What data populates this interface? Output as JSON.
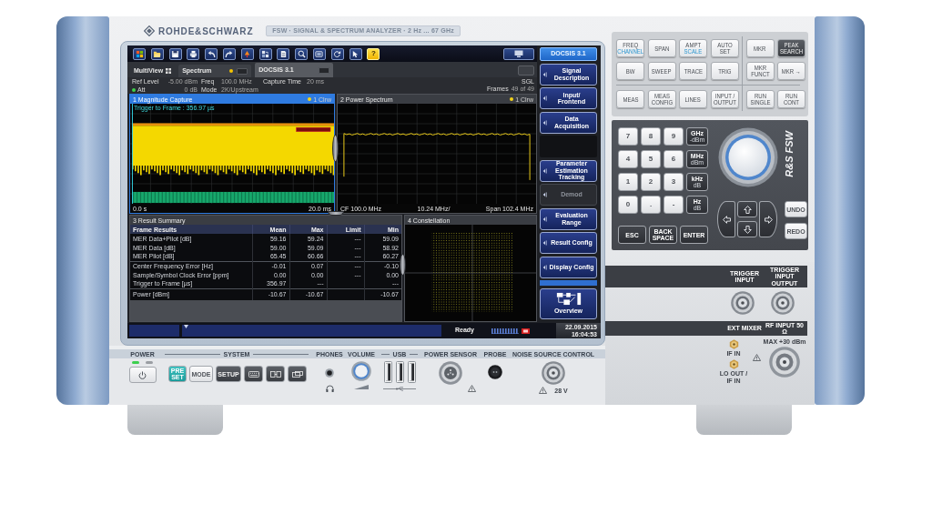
{
  "header": {
    "brand": "ROHDE&SCHWARZ",
    "title": "FSW · SIGNAL & SPECTRUM ANALYZER · 2 Hz ... 67 GHz"
  },
  "screen": {
    "toolbar": [
      {
        "kind": "start",
        "highlighted": false
      },
      {
        "kind": "open",
        "highlighted": false
      },
      {
        "kind": "save",
        "highlighted": false
      },
      {
        "kind": "print",
        "highlighted": false
      },
      {
        "kind": "undo",
        "highlighted": false
      },
      {
        "kind": "redo",
        "highlighted": false
      },
      {
        "kind": "marker",
        "highlighted": false
      },
      {
        "kind": "layout",
        "highlighted": false
      },
      {
        "kind": "report",
        "highlighted": false
      },
      {
        "kind": "zoom",
        "highlighted": false
      },
      {
        "kind": "screen",
        "highlighted": false
      },
      {
        "kind": "refresh",
        "highlighted": false
      },
      {
        "kind": "cursor",
        "highlighted": false
      },
      {
        "kind": "help",
        "label": "?",
        "highlighted": true
      }
    ],
    "softkey_header": "DOCSIS 3.1",
    "tabs": [
      {
        "kind": "multiview",
        "label": "MultiView",
        "selected": false,
        "running": false
      },
      {
        "kind": "channel",
        "label": "Spectrum",
        "selected": false,
        "running": true
      },
      {
        "kind": "channel",
        "label": "DOCSIS 3.1",
        "selected": true,
        "running": false
      }
    ],
    "info": {
      "rows": [
        [
          {
            "label": "Ref Level",
            "value": "-5.00 dBm",
            "dot": false
          },
          {
            "label": "Freq",
            "value": "100.0 MHz",
            "dot": false
          },
          {
            "label": "Capture Time",
            "value": "20 ms",
            "dot": false
          }
        ],
        [
          {
            "label": "Att",
            "value": "0 dB",
            "dot": true
          },
          {
            "label": "Mode",
            "value": "2K/Upstream",
            "dot": false
          }
        ]
      ],
      "sweep": "SGL",
      "frames_label": "Frames",
      "frames": "49 of 49"
    },
    "windows": [
      {
        "kind": "capture",
        "title": "1 Magnitude Capture",
        "selected": true,
        "trace": "1 Clrw",
        "annotation": "Trigger to Frame : 356.97 µs",
        "axis": [
          "0.0 s",
          "20.0 ms"
        ]
      },
      {
        "kind": "spectrum",
        "title": "2 Power Spectrum",
        "selected": false,
        "trace": "1 Clrw",
        "axis": [
          "CF 100.0 MHz",
          "10.24 MHz/",
          "Span 102.4 MHz"
        ]
      },
      {
        "kind": "table",
        "title": "3 Result Summary",
        "selected": false,
        "columns": [
          "Frame Results",
          "Mean",
          "Max",
          "Limit",
          "Min"
        ],
        "groups": [
          [
            {
              "label": "MER Data+Pilot [dB]",
              "mean": "59.16",
              "max": "59.24",
              "limit": "---",
              "min": "59.09"
            },
            {
              "label": "MER Data [dB]",
              "mean": "59.00",
              "max": "59.09",
              "limit": "---",
              "min": "58.92"
            },
            {
              "label": "MER Pilot [dB]",
              "mean": "65.45",
              "max": "60.66",
              "limit": "---",
              "min": "60.27"
            }
          ],
          [
            {
              "label": "Center Frequency Error [Hz]",
              "mean": "-0.01",
              "max": "0.07",
              "limit": "---",
              "min": "-0.10"
            },
            {
              "label": "Sample/Symbol Clock Error [ppm]",
              "mean": "0.00",
              "max": "0.00",
              "limit": "---",
              "min": "0.00"
            },
            {
              "label": "Trigger to Frame [µs]",
              "mean": "356.97",
              "max": "---",
              "min": "---"
            }
          ],
          [
            {
              "label": "Power [dBm]",
              "mean": "-10.67",
              "max": "-10.67",
              "min": "-10.67"
            }
          ]
        ]
      },
      {
        "kind": "constellation",
        "title": "4 Constellation",
        "selected": false
      }
    ],
    "softkeys": [
      {
        "kind": "key",
        "label": "Signal Description",
        "disabled": false
      },
      {
        "kind": "key",
        "label": "Input/ Frontend",
        "disabled": false
      },
      {
        "kind": "key",
        "label": "Data Acquisition",
        "disabled": false
      },
      {
        "kind": "blank"
      },
      {
        "kind": "key",
        "label": "Parameter Estimation Tracking",
        "disabled": false
      },
      {
        "kind": "key",
        "label": "Demod",
        "disabled": true
      },
      {
        "kind": "key",
        "label": "Evaluation Range",
        "disabled": false
      },
      {
        "kind": "key",
        "label": "Result Config",
        "disabled": false
      },
      {
        "kind": "key",
        "label": "Display Config",
        "disabled": false
      },
      {
        "kind": "bar"
      },
      {
        "kind": "overview",
        "label": "Overview"
      }
    ],
    "status_bar": {
      "status": "Ready",
      "date": "22.09.2015",
      "time": "16:04:53"
    }
  },
  "front_panel": {
    "function_keys": [
      [
        {
          "label": "FREQ",
          "sublabel": "CHANNEL",
          "kind": "light"
        },
        {
          "label": "SPAN",
          "kind": "light"
        },
        {
          "label": "AMPT",
          "sublabel": "SCALE",
          "kind": "light"
        },
        {
          "label": "AUTO SET",
          "kind": "light"
        },
        {
          "label": "MKR",
          "kind": "light"
        },
        {
          "label": "PEAK SEARCH",
          "kind": "dark"
        }
      ],
      [
        {
          "label": "BW",
          "kind": "light"
        },
        {
          "label": "SWEEP",
          "kind": "light"
        },
        {
          "label": "TRACE",
          "kind": "light"
        },
        {
          "label": "TRIG",
          "kind": "light"
        },
        {
          "label": "MKR FUNCT",
          "kind": "light"
        },
        {
          "label": "MKR →",
          "kind": "light"
        }
      ],
      [
        {
          "label": "MEAS",
          "kind": "light"
        },
        {
          "label": "MEAS CONFIG",
          "kind": "light"
        },
        {
          "label": "LINES",
          "kind": "light"
        },
        {
          "label": "INPUT / OUTPUT",
          "kind": "light"
        },
        {
          "label": "RUN SINGLE",
          "kind": "light"
        },
        {
          "label": "RUN CONT",
          "kind": "light"
        }
      ]
    ],
    "keypad": {
      "digits": [
        "7",
        "8",
        "9",
        "4",
        "5",
        "6",
        "1",
        "2",
        "3",
        "0",
        ".",
        "-"
      ],
      "units": [
        {
          "label": "GHz",
          "sublabel": "-dBm"
        },
        {
          "label": "MHz",
          "sublabel": "dBm"
        },
        {
          "label": "kHz",
          "sublabel": "dB"
        },
        {
          "label": "Hz",
          "sublabel": "dB"
        }
      ],
      "entry_keys": [
        "ESC",
        "BACK SPACE",
        "ENTER"
      ],
      "edit_keys": [
        "UNDO",
        "REDO"
      ]
    },
    "model": "R&S FSW",
    "connectors": {
      "trigger_labels": [
        "TRIGGER INPUT",
        "TRIGGER INPUT OUTPUT"
      ],
      "rf_labels": [
        "EXT MIXER",
        "RF INPUT 50 Ω"
      ],
      "max_input": "MAX +30 dBm",
      "mixer_ports": [
        "IF IN",
        "LO OUT / IF IN"
      ]
    },
    "bottom_panel": [
      {
        "kind": "power",
        "label": "POWER",
        "leds": [
          {
            "on": true
          },
          {
            "on": false
          }
        ]
      },
      {
        "kind": "system",
        "label": "SYSTEM",
        "keys": [
          {
            "kind": "preset",
            "label": "PRE SET"
          },
          {
            "kind": "light",
            "label": "MODE"
          },
          {
            "kind": "dark",
            "label": "SETUP"
          },
          {
            "kind": "keyboard"
          },
          {
            "kind": "windows"
          },
          {
            "kind": "toggle"
          }
        ]
      },
      {
        "kind": "phones",
        "label": "PHONES"
      },
      {
        "kind": "volume",
        "label": "VOLUME"
      },
      {
        "kind": "usb",
        "label": "USB"
      },
      {
        "kind": "sensor",
        "label": "POWER SENSOR"
      },
      {
        "kind": "probe",
        "label": "PROBE"
      },
      {
        "kind": "noise",
        "label": "NOISE SOURCE CONTROL",
        "note": "28 V"
      }
    ]
  }
}
